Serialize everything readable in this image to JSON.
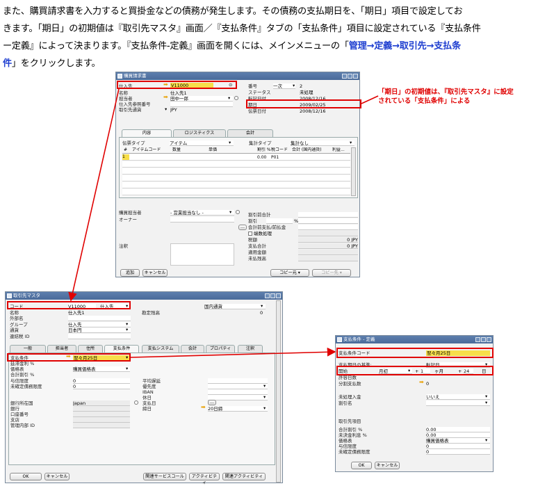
{
  "intro": {
    "p1": "また、購買請求書を入力すると買掛金などの債務が発生します。その債務の支払期日を、「期日」項目で設定してお",
    "p2": "きます。「期日」の初期値は『取引先マスタ』画面／『支払条件』タブの「支払条件」項目に設定されている『支払条件",
    "p3a": "ー定義』によって決まります。『支払条件-定義』画面を開くには、メインメニューの「",
    "p3b": "管理→定義→取引先→支払条",
    "p4a": "件",
    "p4b": "」をクリックします。"
  },
  "note": "「期日」の初期値は、『取引先マスタ』に設定されている「支払条件」による",
  "inv": {
    "title": "購買請求書",
    "vendor_label": "仕入先",
    "vendor_value": "V11000",
    "name_label": "名称",
    "name_value": "仕入先1",
    "contact_label": "担当者",
    "contact_value": "田中一郎",
    "refno_label": "仕入先参照番号",
    "curr_label": "取引先通貨",
    "curr_value": "JPY",
    "no_label": "番号",
    "no_series": "一次",
    "no_value": "2",
    "status_label": "ステータス",
    "status_value": "未処理",
    "post_label": "転記日付",
    "post_value": "2008/12/16",
    "due_label": "期日",
    "due_value": "2009/02/25",
    "doc_label": "伝票日付",
    "doc_value": "2008/12/16",
    "tabs": [
      "内容",
      "ロジスティクス",
      "会計"
    ],
    "itemtype_label": "伝票タイプ",
    "itemtype_value": "アイテム",
    "summary_label": "集計タイプ",
    "summary_value": "集計なし",
    "cols": [
      "#",
      "アイテムコード",
      "数量",
      "単価",
      "割引 %",
      "税コード",
      "合計 (国内通貨)",
      "利益..."
    ],
    "row1_no": "1",
    "row1_disc": "0.00",
    "row1_tax": "P01",
    "buyer_label": "購買担当者",
    "buyer_value": "- 営業担当なし -",
    "owner_label": "オーナー",
    "remark_label": "注釈",
    "totals": [
      "割引前合計",
      "割引",
      "会計前支払/前払金",
      "端数処理",
      "税額",
      "支払合計",
      "適用金額",
      "未払残高"
    ],
    "pct": "%",
    "total_disc_pre": "0 JPY",
    "total_pay": "0 JPY",
    "add": "追加",
    "cancel": "キャンセル",
    "copyfrom": "コピー元",
    "copyto": "コピー先"
  },
  "bp": {
    "title": "取引先マスタ",
    "code_label": "コード",
    "code_value": "V11000",
    "code_type": "仕入先",
    "name_label": "名称",
    "name_value": "仕入先1",
    "fname_label": "外部名",
    "group_label": "グループ",
    "group_value": "仕入先",
    "curr_label": "通貨",
    "curr_value": "日本円",
    "fed_label": "連結税 ID",
    "loc_value": "国内通貨",
    "balance_label": "勘定残高",
    "balance_value": "0",
    "tabs": [
      "一般",
      "担当者",
      "住所",
      "支払条件",
      "支払システム",
      "会計",
      "プロパティ",
      "注釈"
    ],
    "pt_label": "支払条件",
    "pt_value": "翌々月25日",
    "interest_label": "延滞金利 %",
    "pl_label": "価格表",
    "pl_value": "購買価格表",
    "tdisc_label": "合計割引 %",
    "credit_label": "与信限度",
    "credit_value": "0",
    "commit_label": "未確定債務限度",
    "commit_value": "0",
    "avg_label": "平均遅延",
    "priority_label": "優先度",
    "iban_label": "IBAN",
    "holiday_label": "休日",
    "paydate_label": "支払日",
    "duedate_label": "締日",
    "duedate_value": "20日締",
    "bankcountry_label": "銀行所在国",
    "bankcountry_value": "Japan",
    "bank_label": "銀行",
    "account_label": "口座番号",
    "branch_label": "支店",
    "ctrl_label": "管理内部 ID",
    "ok": "OK",
    "cancel": "キャンセル",
    "rel": "関連サービスコール",
    "act": "アクティビティ",
    "relact": "関連アクティビティ"
  },
  "ptd": {
    "title": "支払条件 - 定義",
    "code_label": "支払条件コード",
    "code_value": "翌々月25日",
    "base_label": "支払期日の基準:",
    "base_value": "転記日",
    "start_label": "開始",
    "start_value": "月初",
    "months_value": "1",
    "months_unit": "ヶ月",
    "days_value": "24",
    "days_unit": "日",
    "tol_label": "許容日数",
    "inst_label": "分割支払数",
    "inst_value": "0",
    "open_label": "未処理入金",
    "open_value": "いいえ",
    "disc_label": "割引名",
    "bp_head": "取引先項目",
    "tdisc_label": "合計割引 %",
    "tdisc_value": "0.00",
    "interest_label": "未決金利息 %",
    "interest_value": "0.00",
    "pl_label": "価格表",
    "pl_value": "購買価格表",
    "credit_label": "与信限度",
    "credit_value": "0",
    "commit_label": "未確定債務限度",
    "commit_value": "0",
    "ok": "OK",
    "cancel": "キャンセル"
  }
}
